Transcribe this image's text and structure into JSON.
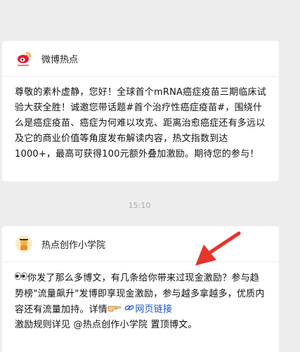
{
  "messages": [
    {
      "sender": "微博热点",
      "avatar_icon": "weibo-logo-icon",
      "body": "尊敬的素朴虚静，您好！全球首个mRNA癌症疫苗三期临床试验大获全胜！诚邀您带话题#首个治疗性癌症疫苗#，围绕什么是癌症疫苗、癌症为何难以攻克、距离治愈癌症还有多远以及它的商业价值等角度发布解读内容，热文指数到达1000+，最高可获得100元额外叠加激励。期待您的参与！"
    },
    {
      "sender": "热点创作小学院",
      "avatar_icon": "academy-avatar-icon",
      "body_part1": "你发了那么多博文，有几条给你带来过现金激励？参与趋势榜\"流量飙升\"发博即享现金激励，参与越多拿越多，优质内容还有流量加持。详情",
      "link_text": "网页链接",
      "body_part2": "激励规则详见 @热点创作小学院 置顶博文。"
    }
  ],
  "timestamp": "15:10",
  "colors": {
    "background": "#ededed",
    "card": "#ffffff",
    "link": "#1a55c9",
    "arrow": "#e5352c"
  }
}
